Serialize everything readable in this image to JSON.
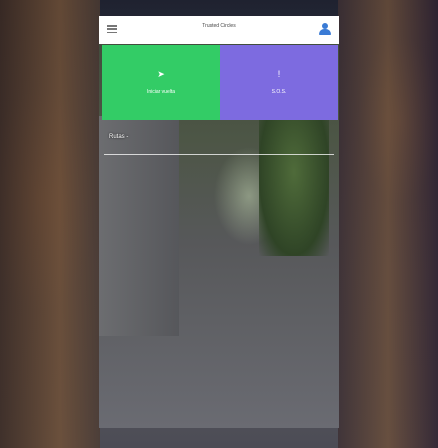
{
  "header": {
    "title": "Trusted Circles"
  },
  "actions": {
    "start_trip_label": "Iniciar vuelta",
    "sos_label": "S.O.S."
  },
  "routes": {
    "label": "Rutas -"
  },
  "icons": {
    "menu": "menu-icon",
    "user": "user-icon",
    "navigation": "navigation-arrow-icon",
    "alert": "exclamation-icon"
  },
  "colors": {
    "start_trip_bg": "#33cc66",
    "sos_bg": "#7d6be0",
    "user_icon": "#3a7bd5",
    "topbar_bg": "#ffffff"
  }
}
